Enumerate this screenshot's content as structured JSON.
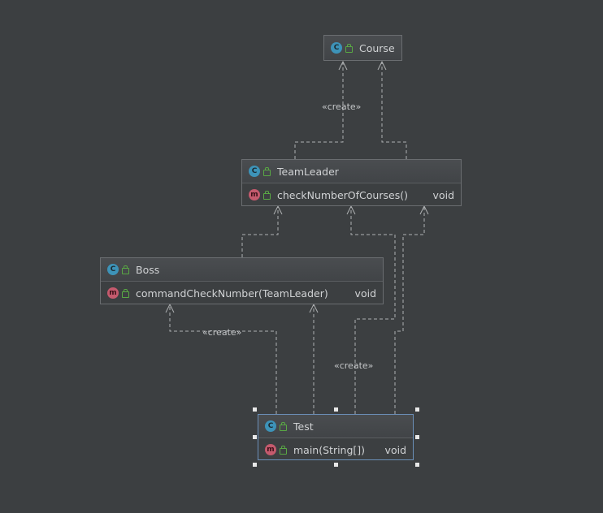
{
  "diagram": {
    "classes": [
      {
        "id": "course",
        "name": "Course",
        "kind": "class",
        "members": []
      },
      {
        "id": "teamleader",
        "name": "TeamLeader",
        "kind": "class",
        "members": [
          {
            "name": "checkNumberOfCourses()",
            "type": "void"
          }
        ]
      },
      {
        "id": "boss",
        "name": "Boss",
        "kind": "class",
        "members": [
          {
            "name": "commandCheckNumber(TeamLeader)",
            "type": "void"
          }
        ]
      },
      {
        "id": "test",
        "name": "Test",
        "kind": "class",
        "selected": true,
        "members": [
          {
            "name": "main(String[])",
            "type": "void"
          }
        ]
      }
    ],
    "class_badge": "C",
    "method_badge": "m",
    "stereotype_create": "«create»",
    "dependencies": [
      {
        "from": "teamleader",
        "to": "course",
        "label": "«create»"
      },
      {
        "from": "teamleader",
        "to": "course"
      },
      {
        "from": "boss",
        "to": "teamleader"
      },
      {
        "from": "test",
        "to": "boss",
        "label": "«create»"
      },
      {
        "from": "test",
        "to": "boss"
      },
      {
        "from": "test",
        "to": "teamleader",
        "label": "«create»"
      },
      {
        "from": "test",
        "to": "teamleader"
      }
    ],
    "icons": {
      "class": "class-icon",
      "method": "method-icon",
      "visibility": "public-visibility-icon"
    },
    "colors": {
      "background": "#3c3f41",
      "line": "#aeb0b2",
      "class_badge": "#3d93b8",
      "method_badge": "#c45a6d",
      "selection": "#6b8fb8"
    }
  }
}
